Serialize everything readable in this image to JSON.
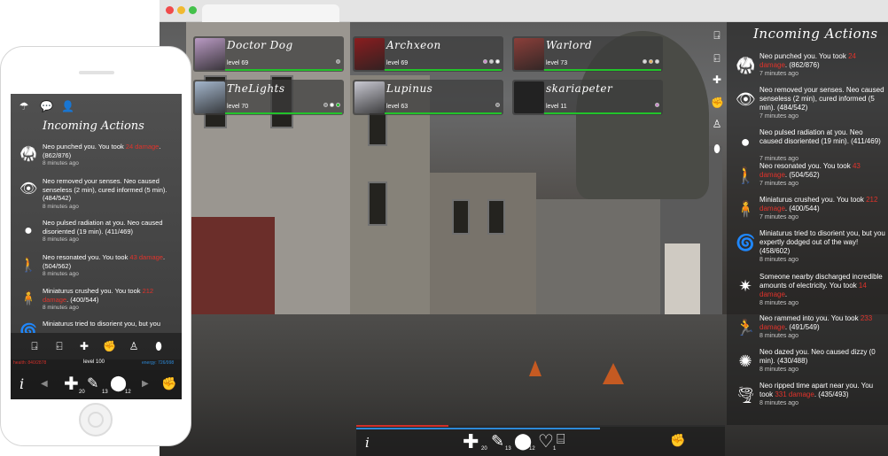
{
  "colors": {
    "damage": "#e0332b",
    "hp_bar": "#22c32a",
    "health_text": "#d2302b",
    "energy_text": "#2d8ad8"
  },
  "players": [
    {
      "name": "Doctor Dog",
      "level": "level 69",
      "avatar_color": "#b99ac3",
      "dots": [
        "#999999"
      ]
    },
    {
      "name": "Archxeon",
      "level": "level 69",
      "avatar_color": "#8a1d1f",
      "dots": [
        "#cc88cc",
        "#cccccc",
        "#ffffff"
      ]
    },
    {
      "name": "Warlord",
      "level": "level 73",
      "avatar_color": "#8b3f3a",
      "dots": [
        "#dddddd",
        "#e9b25a",
        "#dddddd"
      ]
    },
    {
      "name": "TheLights",
      "level": "level 70",
      "avatar_color": "#a4b6cc",
      "dots": [
        "#888888",
        "#ffffff",
        "#22c32a"
      ]
    },
    {
      "name": "Lupinus",
      "level": "level 63",
      "avatar_color": "#c9c9d2",
      "dots": [
        "#888888"
      ]
    },
    {
      "name": "skariapeter",
      "level": "level 11",
      "avatar_color": "#222222",
      "dots": [
        "#cc88cc"
      ]
    }
  ],
  "panel": {
    "title": "Incoming Actions"
  },
  "entries": [
    {
      "icon": "kick-icon",
      "glyph": "🥋",
      "text": "Neo punched you. You took ",
      "damage": "24 damage",
      "after": ". (862/876)",
      "time": "7 minutes ago"
    },
    {
      "icon": "eye-icon",
      "glyph": "👁",
      "text": "Neo removed your senses. Neo caused senseless (2 min), cured informed (5 min). (484/542)",
      "damage": "",
      "after": "",
      "time": "7 minutes ago"
    },
    {
      "icon": "radiation-dot-icon",
      "glyph": "●",
      "text": "Neo pulsed radiation at you. Neo caused disoriented (19 min). (411/469)",
      "damage": "",
      "after": "",
      "time": "7 minutes ago"
    },
    {
      "icon": "resonate-figure-icon",
      "glyph": "🚶",
      "text": "Neo resonated you. You took ",
      "damage": "43 damage",
      "after": ". (504/562)",
      "time": "7 minutes ago"
    },
    {
      "icon": "crush-figure-icon",
      "glyph": "🧍",
      "text": "Miniaturus crushed you. You took ",
      "damage": "212 damage",
      "after": ". (400/544)",
      "time": "7 minutes ago"
    },
    {
      "icon": "spiral-icon",
      "glyph": "🌀",
      "text": "Miniaturus tried to disorient you, but you expertly dodged out of the way! (458/602)",
      "damage": "",
      "after": "",
      "time": "8 minutes ago"
    },
    {
      "icon": "electric-burst-icon",
      "glyph": "✷",
      "text": "Someone nearby discharged incredible amounts of electricity. You took ",
      "damage": "14 damage",
      "after": ".",
      "time": "8 minutes ago"
    },
    {
      "icon": "ram-icon",
      "glyph": "🏃",
      "text": "Neo rammed into you. You took ",
      "damage": "233 damage",
      "after": ". (491/549)",
      "time": "8 minutes ago"
    },
    {
      "icon": "dizzy-icon",
      "glyph": "✺",
      "text": "Neo dazed you. Neo caused dizzy (0 min). (430/488)",
      "damage": "",
      "after": "",
      "time": "8 minutes ago"
    },
    {
      "icon": "vortex-icon",
      "glyph": "🌪",
      "text": "Neo ripped time apart near you. You took ",
      "damage": "331 damage",
      "after": ". (435/493)",
      "time": "8 minutes ago"
    }
  ],
  "phone_entries": [
    {
      "icon": "kick-icon",
      "glyph": "🥋",
      "text": "Neo punched you. You took ",
      "damage": "24 damage",
      "after": ". (862/876)",
      "time": "8 minutes ago"
    },
    {
      "icon": "eye-icon",
      "glyph": "👁",
      "text": "Neo removed your senses. Neo caused senseless (2 min), cured informed (5 min). (484/542)",
      "damage": "",
      "after": "",
      "time": "8 minutes ago"
    },
    {
      "icon": "radiation-dot-icon",
      "glyph": "●",
      "text": "Neo pulsed radiation at you. Neo caused disoriented (19 min). (411/469)",
      "damage": "",
      "after": "",
      "time": "8 minutes ago"
    },
    {
      "icon": "resonate-figure-icon",
      "glyph": "🚶",
      "text": "Neo resonated you. You took ",
      "damage": "43 damage",
      "after": ". (504/562)",
      "time": "8 minutes ago"
    },
    {
      "icon": "crush-figure-icon",
      "glyph": "🧍",
      "text": "Miniaturus crushed you. You took ",
      "damage": "212 damage",
      "after": ". (400/544)",
      "time": "8 minutes ago"
    },
    {
      "icon": "spiral-icon",
      "glyph": "🌀",
      "text": "Miniaturus tried to disorient you, but you",
      "damage": "",
      "after": "",
      "time": ""
    }
  ],
  "phone_status": {
    "health": "health: 840/2878",
    "level": "level 100",
    "energy": "energy: 726/998"
  },
  "bottom_bar": {
    "info": "i",
    "plus_count": "20",
    "bandage_count": "13",
    "brain_count": "12",
    "heart_count": "1",
    "hp_fraction": 0.25,
    "xp_fraction": 0.66
  }
}
